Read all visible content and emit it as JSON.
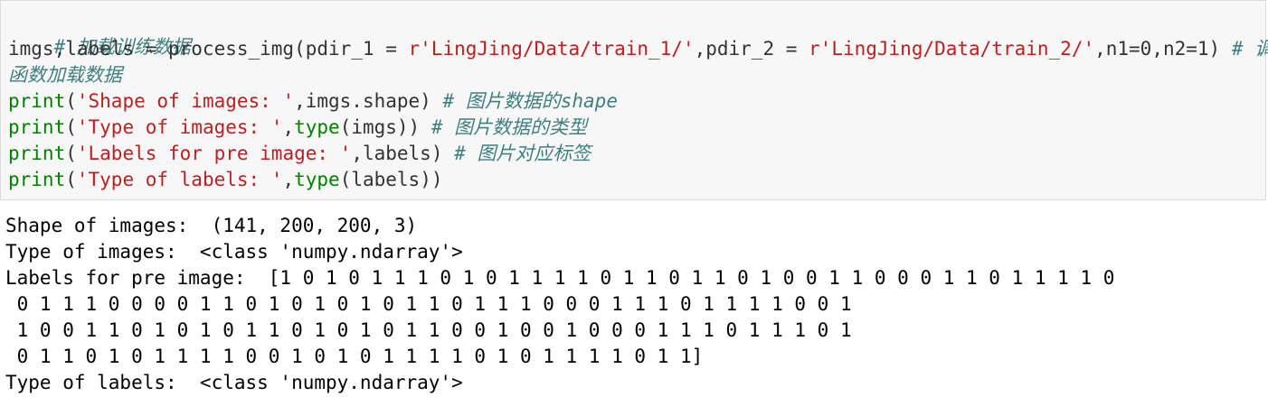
{
  "code_cell": {
    "line1_comment": "# 加载训练数据",
    "line2": {
      "prefix": "imgs,labels = process_img(pdir_1 = ",
      "str1": "r'LingJing/Data/train_1/'",
      "mid": ",pdir_2 = ",
      "str2": "r'LingJing/Data/train_2/'",
      "suffix": ",n1=0,n2=1) ",
      "comment": "# 调用"
    },
    "line3_comment_cont": "函数加载数据",
    "line4": {
      "fn": "print",
      "open": "(",
      "str": "'Shape of images: '",
      "rest": ",imgs.shape) ",
      "comment": "# 图片数据的shape"
    },
    "line5": {
      "fn": "print",
      "open": "(",
      "str": "'Type of images: '",
      "mid": ",",
      "fn2": "type",
      "rest": "(imgs)) ",
      "comment": "# 图片数据的类型"
    },
    "line6": {
      "fn": "print",
      "open": "(",
      "str": "'Labels for pre image: '",
      "rest": ",labels) ",
      "comment": "# 图片对应标签"
    },
    "line7": {
      "fn": "print",
      "open": "(",
      "str": "'Type of labels: '",
      "mid": ",",
      "fn2": "type",
      "rest": "(labels))"
    }
  },
  "output": {
    "lines": [
      "Shape of images:  (141, 200, 200, 3)",
      "Type of images:  <class 'numpy.ndarray'>",
      "Labels for pre image:  [1 0 1 0 1 1 1 0 1 0 1 1 1 1 0 1 1 0 1 1 0 1 0 0 1 1 0 0 0 1 1 0 1 1 1 1 0",
      " 0 1 1 1 0 0 0 0 1 1 0 1 0 1 0 1 0 1 1 0 1 1 1 0 0 0 1 1 1 0 1 1 1 1 0 0 1",
      " 1 0 0 1 1 0 1 0 1 0 1 1 0 1 0 1 0 1 1 0 0 1 0 0 1 0 0 0 1 1 1 0 1 1 1 0 1",
      " 0 1 1 0 1 0 1 1 1 1 0 0 1 0 1 0 1 1 1 1 0 1 0 1 1 1 1 0 1 1]",
      "Type of labels:  <class 'numpy.ndarray'>"
    ]
  },
  "colors": {
    "code_bg": "#f7f7f7",
    "builtin": "#008000",
    "string": "#ba2121",
    "comment": "#408080"
  }
}
